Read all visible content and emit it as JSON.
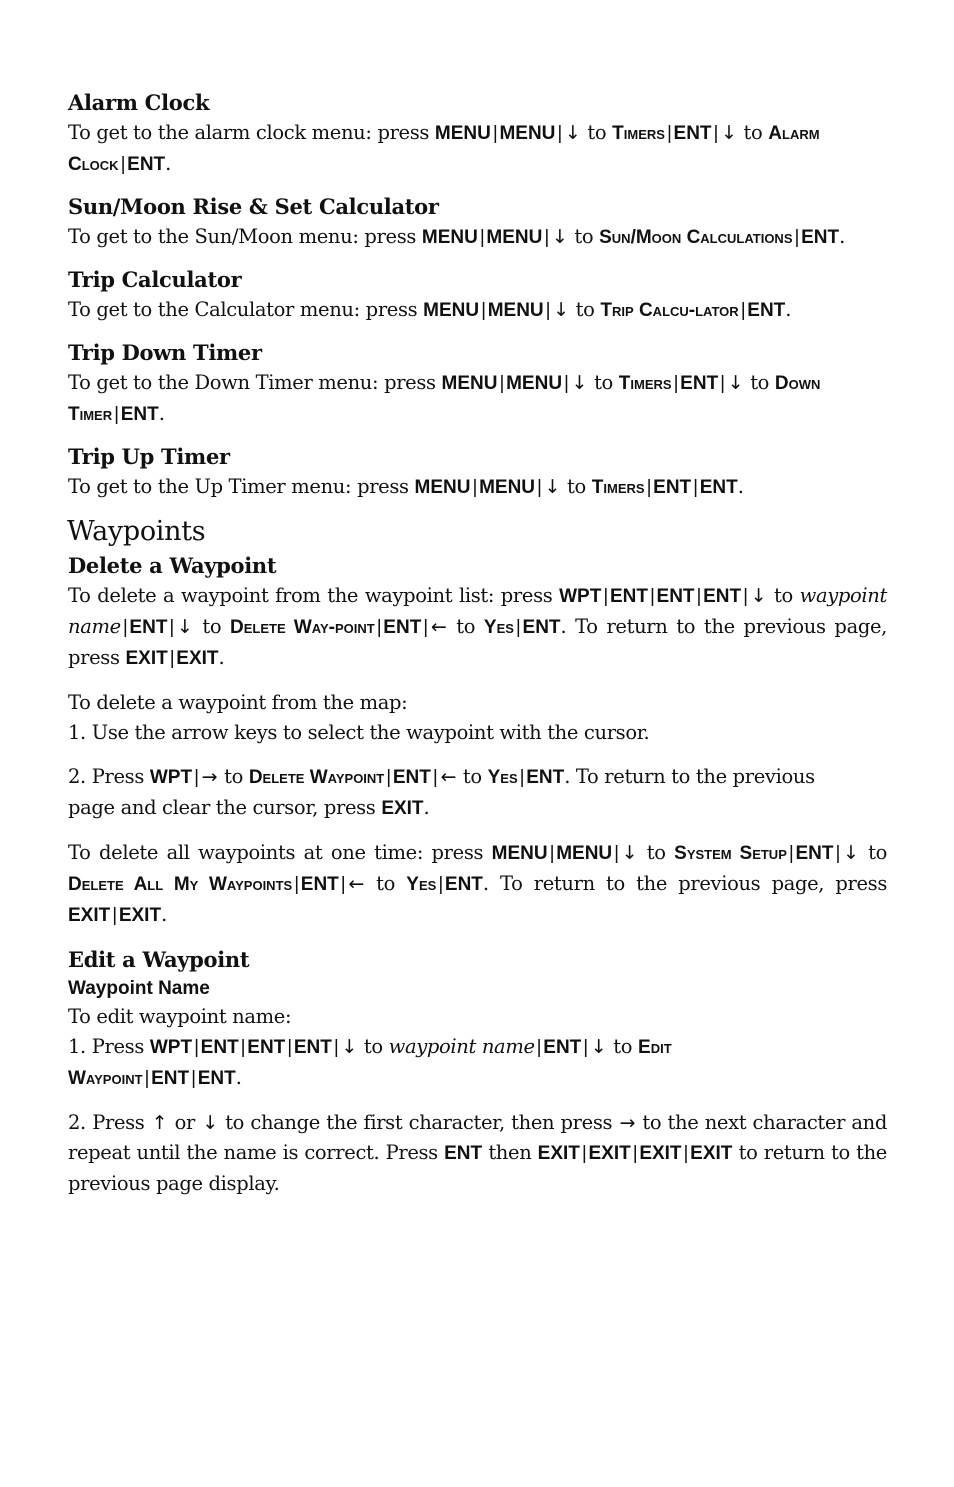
{
  "sections": [
    {
      "heading": "Alarm Clock",
      "paragraphs": [
        {
          "justify": false,
          "segs": [
            {
              "t": "txt",
              "v": "To get to the alarm clock menu: press "
            },
            {
              "t": "key",
              "v": "MENU"
            },
            {
              "t": "sep",
              "v": "|"
            },
            {
              "t": "key",
              "v": "MENU"
            },
            {
              "t": "sep",
              "v": "|"
            },
            {
              "t": "arrow",
              "v": "↓"
            },
            {
              "t": "txt",
              "v": " to "
            },
            {
              "t": "sc",
              "v": "Timers"
            },
            {
              "t": "sep",
              "v": "|"
            },
            {
              "t": "key",
              "v": "ENT"
            },
            {
              "t": "sep",
              "v": "|"
            },
            {
              "t": "arrow",
              "v": "↓"
            },
            {
              "t": "txt",
              "v": " to "
            },
            {
              "t": "sc",
              "v": "Alarm Clock"
            },
            {
              "t": "sep",
              "v": "|"
            },
            {
              "t": "key",
              "v": "ENT"
            },
            {
              "t": "txt",
              "v": "."
            }
          ]
        }
      ]
    },
    {
      "heading": "Sun/Moon Rise & Set Calculator",
      "paragraphs": [
        {
          "justify": true,
          "segs": [
            {
              "t": "txt",
              "v": "To get to the Sun/Moon menu: press "
            },
            {
              "t": "key",
              "v": "MENU"
            },
            {
              "t": "sep",
              "v": "|"
            },
            {
              "t": "key",
              "v": "MENU"
            },
            {
              "t": "sep",
              "v": "|"
            },
            {
              "t": "arrow",
              "v": "↓"
            },
            {
              "t": "txt",
              "v": " to "
            },
            {
              "t": "sc",
              "v": "Sun/Moon Calculations"
            },
            {
              "t": "sep",
              "v": "|"
            },
            {
              "t": "key",
              "v": "ENT"
            },
            {
              "t": "txt",
              "v": "."
            }
          ]
        }
      ]
    },
    {
      "heading": "Trip Calculator",
      "paragraphs": [
        {
          "justify": true,
          "segs": [
            {
              "t": "txt",
              "v": "To get to the Calculator menu: press "
            },
            {
              "t": "key",
              "v": "MENU"
            },
            {
              "t": "sep",
              "v": "|"
            },
            {
              "t": "key",
              "v": "MENU"
            },
            {
              "t": "sep",
              "v": "|"
            },
            {
              "t": "arrow",
              "v": "↓"
            },
            {
              "t": "txt",
              "v": " to "
            },
            {
              "t": "sc",
              "v": "Trip Calcu-lator"
            },
            {
              "t": "sep",
              "v": "|"
            },
            {
              "t": "key",
              "v": "ENT"
            },
            {
              "t": "txt",
              "v": "."
            }
          ]
        }
      ]
    },
    {
      "heading": "Trip Down Timer",
      "paragraphs": [
        {
          "justify": false,
          "segs": [
            {
              "t": "txt",
              "v": "To get to the Down Timer menu: press "
            },
            {
              "t": "key",
              "v": "MENU"
            },
            {
              "t": "sep",
              "v": "|"
            },
            {
              "t": "key",
              "v": "MENU"
            },
            {
              "t": "sep",
              "v": "|"
            },
            {
              "t": "arrow",
              "v": "↓"
            },
            {
              "t": "txt",
              "v": " to "
            },
            {
              "t": "sc",
              "v": "Timers"
            },
            {
              "t": "sep",
              "v": "|"
            },
            {
              "t": "key",
              "v": "ENT"
            },
            {
              "t": "sep",
              "v": "|"
            },
            {
              "t": "arrow",
              "v": "↓"
            },
            {
              "t": "txt",
              "v": " to "
            },
            {
              "t": "sc",
              "v": "Down Timer"
            },
            {
              "t": "sep",
              "v": "|"
            },
            {
              "t": "key",
              "v": "ENT"
            },
            {
              "t": "txt",
              "v": "."
            }
          ]
        }
      ]
    },
    {
      "heading": "Trip Up Timer",
      "paragraphs": [
        {
          "justify": false,
          "segs": [
            {
              "t": "txt",
              "v": "To get to the Up Timer menu: press "
            },
            {
              "t": "key",
              "v": "MENU"
            },
            {
              "t": "sep",
              "v": "|"
            },
            {
              "t": "key",
              "v": "MENU"
            },
            {
              "t": "sep",
              "v": "|"
            },
            {
              "t": "arrow",
              "v": "↓"
            },
            {
              "t": "txt",
              "v": " to "
            },
            {
              "t": "sc",
              "v": "Timers"
            },
            {
              "t": "sep",
              "v": "|"
            },
            {
              "t": "key",
              "v": "ENT"
            },
            {
              "t": "sep",
              "v": "|"
            },
            {
              "t": "key",
              "v": "ENT"
            },
            {
              "t": "txt",
              "v": "."
            }
          ]
        }
      ]
    }
  ],
  "waypoints": {
    "title": "Waypoints",
    "delete": {
      "heading": "Delete a Waypoint",
      "paragraphs": [
        {
          "justify": true,
          "segs": [
            {
              "t": "txt",
              "v": "To delete a waypoint from the waypoint list: press "
            },
            {
              "t": "key",
              "v": "WPT"
            },
            {
              "t": "sep",
              "v": "|"
            },
            {
              "t": "key",
              "v": "ENT"
            },
            {
              "t": "sep",
              "v": "|"
            },
            {
              "t": "key",
              "v": "ENT"
            },
            {
              "t": "sep",
              "v": "|"
            },
            {
              "t": "key",
              "v": "ENT"
            },
            {
              "t": "sep",
              "v": "|"
            },
            {
              "t": "arrow",
              "v": "↓"
            },
            {
              "t": "txt",
              "v": " to "
            },
            {
              "t": "em",
              "v": "waypoint name"
            },
            {
              "t": "sep",
              "v": "|"
            },
            {
              "t": "key",
              "v": "ENT"
            },
            {
              "t": "sep",
              "v": "|"
            },
            {
              "t": "arrow",
              "v": "↓"
            },
            {
              "t": "txt",
              "v": " to "
            },
            {
              "t": "sc",
              "v": "Delete Way-point"
            },
            {
              "t": "sep",
              "v": "|"
            },
            {
              "t": "key",
              "v": "ENT"
            },
            {
              "t": "sep",
              "v": "|"
            },
            {
              "t": "arrow",
              "v": "←"
            },
            {
              "t": "txt",
              "v": " to "
            },
            {
              "t": "sc",
              "v": "Yes"
            },
            {
              "t": "sep",
              "v": "|"
            },
            {
              "t": "key",
              "v": "ENT"
            },
            {
              "t": "txt",
              "v": ". To return to the previous page, press "
            },
            {
              "t": "key",
              "v": "EXIT"
            },
            {
              "t": "sep",
              "v": "|"
            },
            {
              "t": "key",
              "v": "EXIT"
            },
            {
              "t": "txt",
              "v": "."
            }
          ]
        },
        {
          "justify": false,
          "segs": [
            {
              "t": "txt",
              "v": "To delete a waypoint from the map:"
            }
          ],
          "nogap": true
        },
        {
          "justify": false,
          "segs": [
            {
              "t": "txt",
              "v": "1. Use the arrow keys to select the waypoint with the cursor."
            }
          ]
        },
        {
          "justify": false,
          "segs": [
            {
              "t": "txt",
              "v": "2. Press "
            },
            {
              "t": "key",
              "v": "WPT"
            },
            {
              "t": "sep",
              "v": "|"
            },
            {
              "t": "arrow",
              "v": "→"
            },
            {
              "t": "txt",
              "v": " to "
            },
            {
              "t": "sc",
              "v": "Delete Waypoint"
            },
            {
              "t": "sep",
              "v": "|"
            },
            {
              "t": "key",
              "v": "ENT"
            },
            {
              "t": "sep",
              "v": "|"
            },
            {
              "t": "arrow",
              "v": "←"
            },
            {
              "t": "txt",
              "v": " to "
            },
            {
              "t": "sc",
              "v": "Yes"
            },
            {
              "t": "sep",
              "v": "|"
            },
            {
              "t": "key",
              "v": "ENT"
            },
            {
              "t": "txt",
              "v": ". To return to the previous page and clear the cursor, press "
            },
            {
              "t": "key",
              "v": "EXIT"
            },
            {
              "t": "txt",
              "v": "."
            }
          ],
          "narrow": true
        },
        {
          "justify": true,
          "segs": [
            {
              "t": "txt",
              "v": "To delete all waypoints at one time: press "
            },
            {
              "t": "key",
              "v": "MENU"
            },
            {
              "t": "sep",
              "v": "|"
            },
            {
              "t": "key",
              "v": "MENU"
            },
            {
              "t": "sep",
              "v": "|"
            },
            {
              "t": "arrow",
              "v": "↓"
            },
            {
              "t": "txt",
              "v": " to "
            },
            {
              "t": "sc",
              "v": "System Setup"
            },
            {
              "t": "sep",
              "v": "|"
            },
            {
              "t": "key",
              "v": "ENT"
            },
            {
              "t": "sep",
              "v": "|"
            },
            {
              "t": "arrow",
              "v": "↓"
            },
            {
              "t": "txt",
              "v": " to "
            },
            {
              "t": "sc",
              "v": "Delete All My Waypoints"
            },
            {
              "t": "sep",
              "v": "|"
            },
            {
              "t": "key",
              "v": "ENT"
            },
            {
              "t": "sep",
              "v": "|"
            },
            {
              "t": "arrow",
              "v": "←"
            },
            {
              "t": "txt",
              "v": " to "
            },
            {
              "t": "sc",
              "v": "Yes"
            },
            {
              "t": "sep",
              "v": "|"
            },
            {
              "t": "key",
              "v": "ENT"
            },
            {
              "t": "txt",
              "v": ". To return to the previous page, press "
            },
            {
              "t": "key",
              "v": "EXIT"
            },
            {
              "t": "sep",
              "v": "|"
            },
            {
              "t": "key",
              "v": "EXIT"
            },
            {
              "t": "txt",
              "v": "."
            }
          ]
        }
      ]
    },
    "edit": {
      "heading": "Edit a Waypoint",
      "subheading": "Waypoint Name",
      "paragraphs": [
        {
          "justify": false,
          "segs": [
            {
              "t": "txt",
              "v": "To edit waypoint name:"
            }
          ],
          "nogap": true
        },
        {
          "justify": false,
          "segs": [
            {
              "t": "txt",
              "v": "1. Press "
            },
            {
              "t": "key",
              "v": "WPT"
            },
            {
              "t": "sep",
              "v": "|"
            },
            {
              "t": "key",
              "v": "ENT"
            },
            {
              "t": "sep",
              "v": "|"
            },
            {
              "t": "key",
              "v": "ENT"
            },
            {
              "t": "sep",
              "v": "|"
            },
            {
              "t": "key",
              "v": "ENT"
            },
            {
              "t": "sep",
              "v": "|"
            },
            {
              "t": "arrow",
              "v": "↓"
            },
            {
              "t": "txt",
              "v": " to "
            },
            {
              "t": "em",
              "v": "waypoint name"
            },
            {
              "t": "sep",
              "v": "|"
            },
            {
              "t": "key",
              "v": "ENT"
            },
            {
              "t": "sep",
              "v": "|"
            },
            {
              "t": "arrow",
              "v": "↓"
            },
            {
              "t": "txt",
              "v": " to "
            },
            {
              "t": "sc",
              "v": "Edit Waypoint"
            },
            {
              "t": "sep",
              "v": "|"
            },
            {
              "t": "key",
              "v": "ENT"
            },
            {
              "t": "sep",
              "v": "|"
            },
            {
              "t": "key",
              "v": "ENT"
            },
            {
              "t": "txt",
              "v": "."
            }
          ],
          "narrow2": true
        },
        {
          "justify": true,
          "segs": [
            {
              "t": "txt",
              "v": "2. Press "
            },
            {
              "t": "arrow",
              "v": "↑"
            },
            {
              "t": "txt",
              "v": " or "
            },
            {
              "t": "arrow",
              "v": "↓"
            },
            {
              "t": "txt",
              "v": "  to change the first character, then press "
            },
            {
              "t": "arrow",
              "v": "→"
            },
            {
              "t": "txt",
              "v": " to the next character and repeat until the name is correct. Press "
            },
            {
              "t": "key",
              "v": "ENT"
            },
            {
              "t": "txt",
              "v": " then "
            },
            {
              "t": "key",
              "v": "EXIT"
            },
            {
              "t": "sep",
              "v": "|"
            },
            {
              "t": "key",
              "v": "EXIT"
            },
            {
              "t": "sep",
              "v": "|"
            },
            {
              "t": "key",
              "v": "EXIT"
            },
            {
              "t": "sep",
              "v": "|"
            },
            {
              "t": "key",
              "v": "EXIT"
            },
            {
              "t": "txt",
              "v": " to return to the previous page display."
            }
          ]
        }
      ]
    }
  }
}
